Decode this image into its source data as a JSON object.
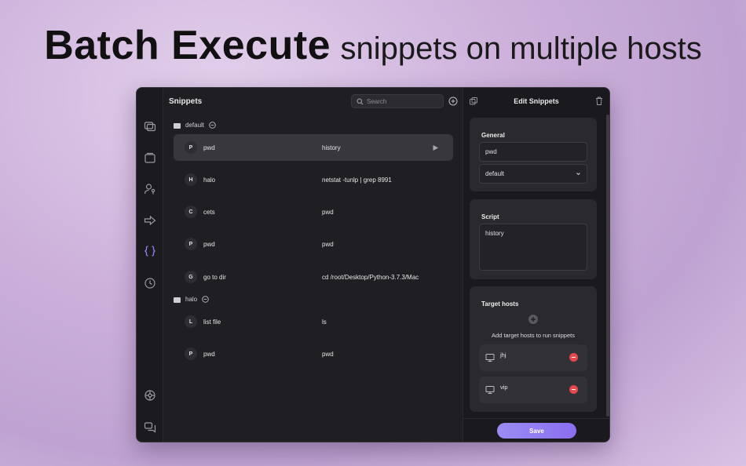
{
  "headline": {
    "bold": "Batch Execute",
    "light": "snippets on multiple hosts"
  },
  "sidebar": {
    "icons": [
      "terminals-icon",
      "vault-icon",
      "user-key-icon",
      "port-forward-icon",
      "snippets-icon",
      "history-icon",
      "settings-icon",
      "chat-icon"
    ],
    "active": "snippets-icon"
  },
  "list": {
    "title": "Snippets",
    "search_placeholder": "Search",
    "groups": [
      {
        "name": "default",
        "rows": [
          {
            "initial": "P",
            "name": "pwd",
            "cmd": "history",
            "selected": true
          },
          {
            "initial": "H",
            "name": "halo",
            "cmd": "netstat -tunlp | grep 8991"
          },
          {
            "initial": "C",
            "name": "cets",
            "cmd": "pwd"
          },
          {
            "initial": "P",
            "name": "pwd",
            "cmd": "pwd"
          },
          {
            "initial": "G",
            "name": "go to dir",
            "cmd": "cd /root/Desktop/Python-3.7.3/Mac"
          }
        ]
      },
      {
        "name": "halo",
        "rows": [
          {
            "initial": "L",
            "name": "list file",
            "cmd": "ls"
          },
          {
            "initial": "P",
            "name": "pwd",
            "cmd": "pwd"
          }
        ]
      }
    ]
  },
  "edit": {
    "title": "Edit Snippets",
    "general_label": "General",
    "name_value": "pwd",
    "group_value": "default",
    "script_label": "Script",
    "script_value": "history",
    "targets_label": "Target hosts",
    "add_hint": "Add target hosts to run snippets",
    "hosts": [
      "jhj",
      "vip"
    ],
    "save_label": "Save"
  },
  "colors": {
    "accent": "#8c86ff",
    "save_gradient_start": "#9b8cf3",
    "remove": "#e5484d"
  }
}
